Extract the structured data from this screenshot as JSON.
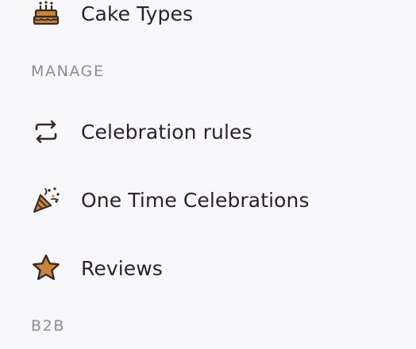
{
  "sidebar": {
    "items": [
      {
        "label": "Cake Types",
        "icon": "cake-icon"
      },
      {
        "label": "Celebration rules",
        "icon": "repeat-icon"
      },
      {
        "label": "One Time Celebrations",
        "icon": "party-popper-icon"
      },
      {
        "label": "Reviews",
        "icon": "star-icon"
      }
    ],
    "sections": [
      {
        "title": "MANAGE"
      },
      {
        "title": "B2B"
      }
    ]
  },
  "colors": {
    "background": "#f8f8fb",
    "text": "#2b2228",
    "section_heading": "#8f8b93",
    "icon_fill": "#c8853c",
    "icon_stroke": "#3a2a24"
  }
}
